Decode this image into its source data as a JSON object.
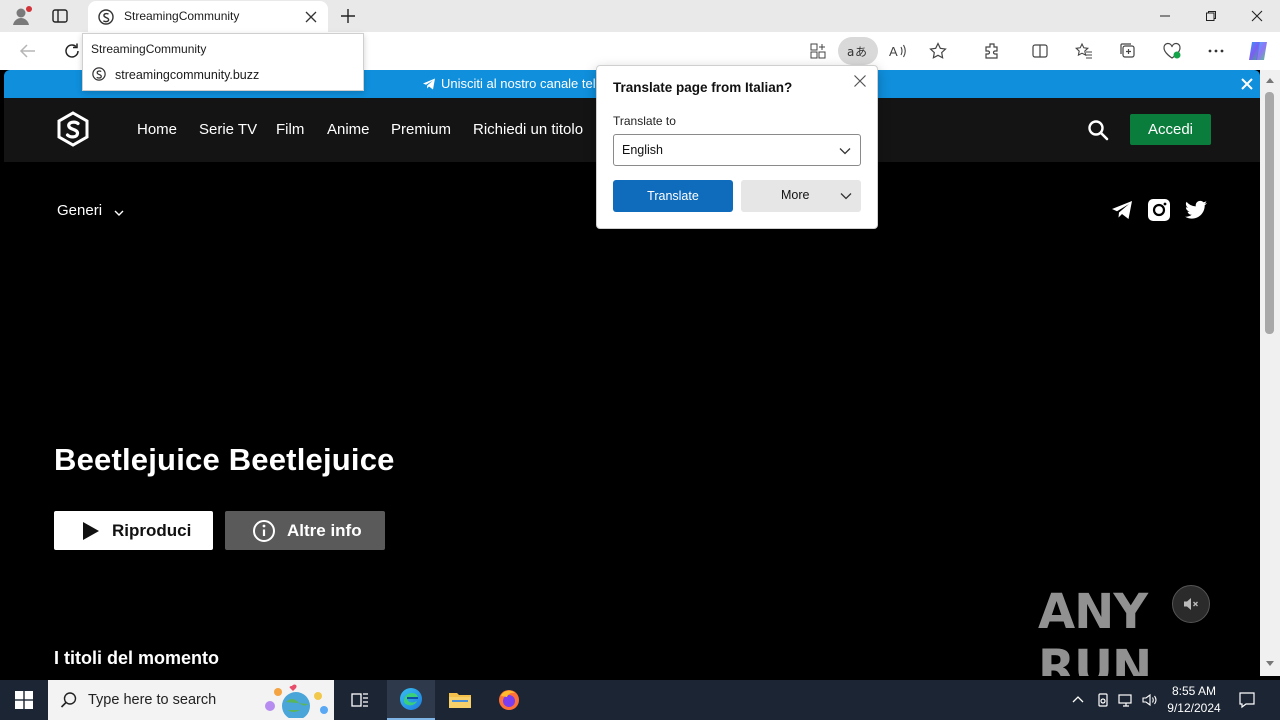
{
  "browser": {
    "tab_title": "StreamingCommunity",
    "url_popup": {
      "site_name": "StreamingCommunity",
      "site_url": "streamingcommunity.buzz"
    }
  },
  "page": {
    "banner_text": "Unisciti al nostro canale tel",
    "nav": {
      "links": [
        "Home",
        "Serie TV",
        "Film",
        "Anime",
        "Premium",
        "Richiedi un titolo"
      ],
      "login_label": "Accedi"
    },
    "genre_label": "Generi",
    "hero": {
      "title": "Beetlejuice Beetlejuice",
      "play_label": "Riproduci",
      "info_label": "Altre info"
    },
    "section_title": "I titoli del momento",
    "watermark": "ANY RUN"
  },
  "translate_popup": {
    "title": "Translate page from Italian?",
    "label": "Translate to",
    "selected_language": "English",
    "translate_label": "Translate",
    "more_label": "More"
  },
  "taskbar": {
    "search_placeholder": "Type here to search",
    "time": "8:55 AM",
    "date": "9/12/2024"
  },
  "colors": {
    "banner": "#0f8fdc",
    "login_button": "#0a7d3c",
    "translate_button": "#0f6cbd"
  }
}
